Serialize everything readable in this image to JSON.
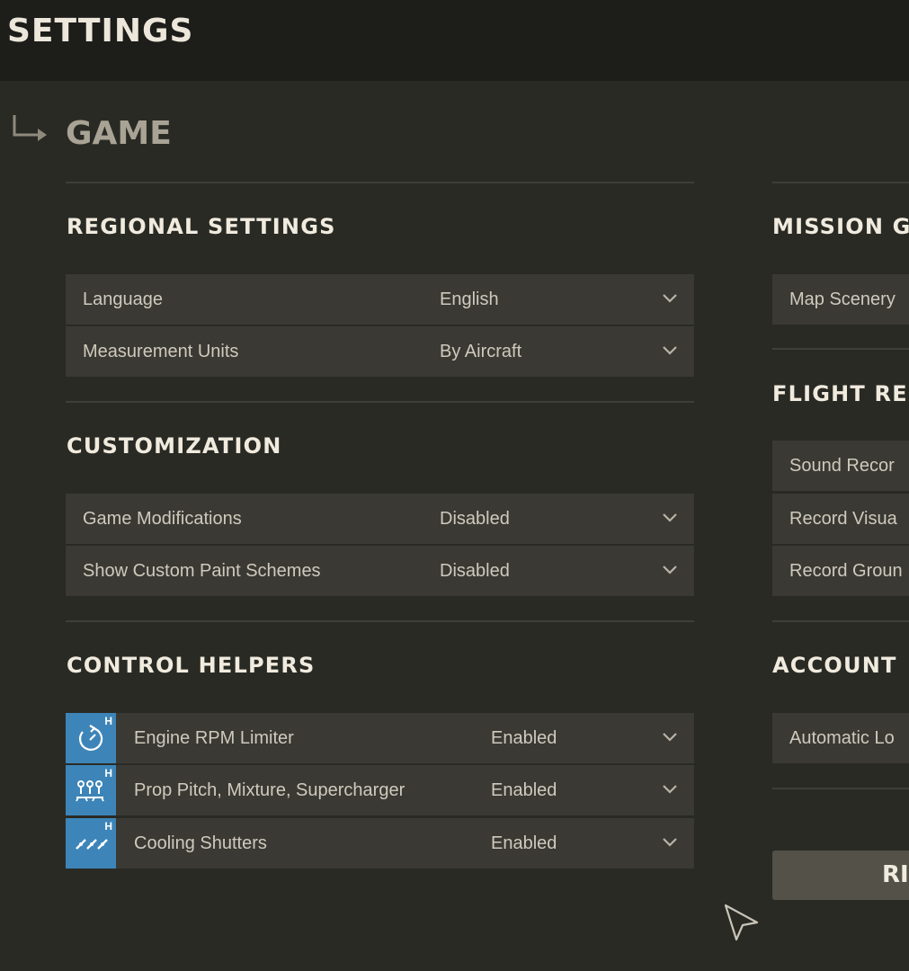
{
  "header": {
    "title": "SETTINGS"
  },
  "section": {
    "title": "GAME"
  },
  "left": {
    "regional": {
      "title": "REGIONAL SETTINGS",
      "rows": [
        {
          "label": "Language",
          "value": "English"
        },
        {
          "label": "Measurement Units",
          "value": "By Aircraft"
        }
      ]
    },
    "customization": {
      "title": "CUSTOMIZATION",
      "rows": [
        {
          "label": "Game Modifications",
          "value": "Disabled"
        },
        {
          "label": "Show Custom Paint Schemes",
          "value": "Disabled"
        }
      ]
    },
    "control_helpers": {
      "title": "CONTROL HELPERS",
      "badge": "H",
      "rows": [
        {
          "label": "Engine RPM Limiter",
          "value": "Enabled",
          "icon": "rpm-limiter-icon"
        },
        {
          "label": "Prop Pitch, Mixture, Supercharger",
          "value": "Enabled",
          "icon": "prop-pitch-icon"
        },
        {
          "label": "Cooling Shutters",
          "value": "Enabled",
          "icon": "cooling-shutters-icon"
        }
      ]
    }
  },
  "right": {
    "mission": {
      "title": "MISSION G",
      "rows": [
        {
          "label": "Map Scenery"
        }
      ]
    },
    "flight_rec": {
      "title": "FLIGHT REC",
      "rows": [
        {
          "label": "Sound Recor"
        },
        {
          "label": "Record Visua"
        },
        {
          "label": "Record Groun"
        }
      ]
    },
    "account": {
      "title": "ACCOUNT",
      "rows": [
        {
          "label": "Automatic Lo"
        }
      ]
    },
    "reset_button": "RI"
  },
  "colors": {
    "accent_icon": "#3d85b8",
    "row_bg": "#3a3933",
    "background": "#2a2a25"
  }
}
